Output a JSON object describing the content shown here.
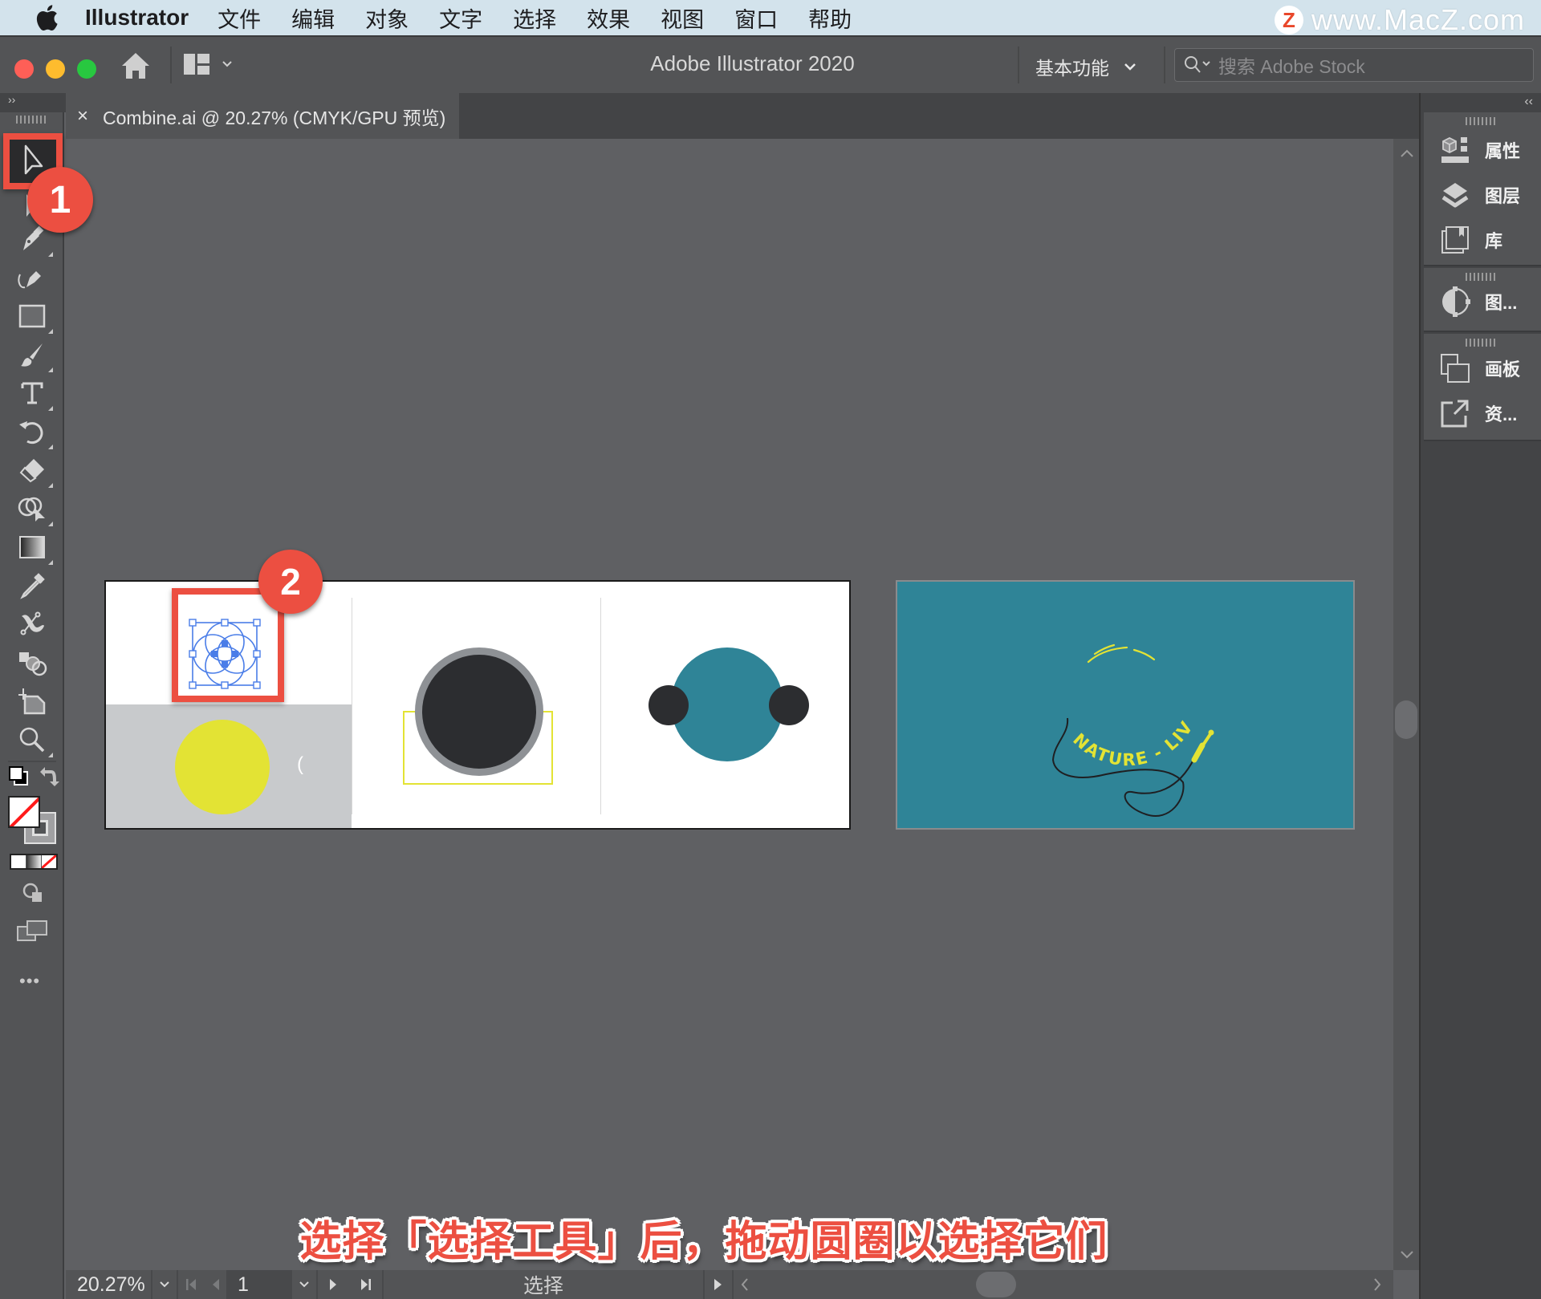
{
  "menubar": {
    "app_name": "Illustrator",
    "items": [
      "文件",
      "编辑",
      "对象",
      "文字",
      "选择",
      "效果",
      "视图",
      "窗口",
      "帮助"
    ],
    "watermark": "www.MacZ.com",
    "watermark_logo": "Z"
  },
  "titlebar": {
    "title": "Adobe Illustrator 2020",
    "workspace_label": "基本功能",
    "search_placeholder": "搜索 Adobe Stock"
  },
  "tab": {
    "close_glyph": "×",
    "label": "Combine.ai @ 20.27% (CMYK/GPU 预览)"
  },
  "toolbar": {
    "collapse_glyph": "››",
    "tools": [
      "selection-tool",
      "direct-selection-tool",
      "pen-tool",
      "curvature-tool",
      "rectangle-tool",
      "paintbrush-tool",
      "type-tool",
      "rotate-tool",
      "eraser-tool",
      "shape-builder-tool",
      "gradient-tool",
      "eyedropper-tool",
      "puppet-warp-tool",
      "blend-tool",
      "artboard-tool",
      "zoom-tool"
    ],
    "more_glyph": "•••"
  },
  "right_panel": {
    "collapse_glyph": "‹‹",
    "groups": [
      {
        "items": [
          {
            "icon": "properties-icon",
            "label": "属性"
          },
          {
            "icon": "layers-icon",
            "label": "图层"
          },
          {
            "icon": "libraries-icon",
            "label": "库"
          }
        ]
      },
      {
        "items": [
          {
            "icon": "graphic-styles-icon",
            "label": "图..."
          }
        ]
      },
      {
        "items": [
          {
            "icon": "artboards-icon",
            "label": "画板"
          },
          {
            "icon": "asset-export-icon",
            "label": "资..."
          }
        ]
      }
    ]
  },
  "artwork": {
    "text_on_path": "NATURE - LIVE",
    "colors": {
      "yellow": "#e3e334",
      "teal": "#2f8497",
      "dark": "#2c2d30",
      "gray_ring": "#8e9195",
      "light_gray_bg": "#c8cacc",
      "selection_blue": "#4a7de8"
    }
  },
  "annotations": {
    "step1": "1",
    "step2": "2",
    "caption": "选择「选择工具」后，拖动圆圈以选择它们",
    "accent": "#ec4f41"
  },
  "statusbar": {
    "zoom": "20.27%",
    "artboard_number": "1",
    "tool_status": "选择"
  }
}
